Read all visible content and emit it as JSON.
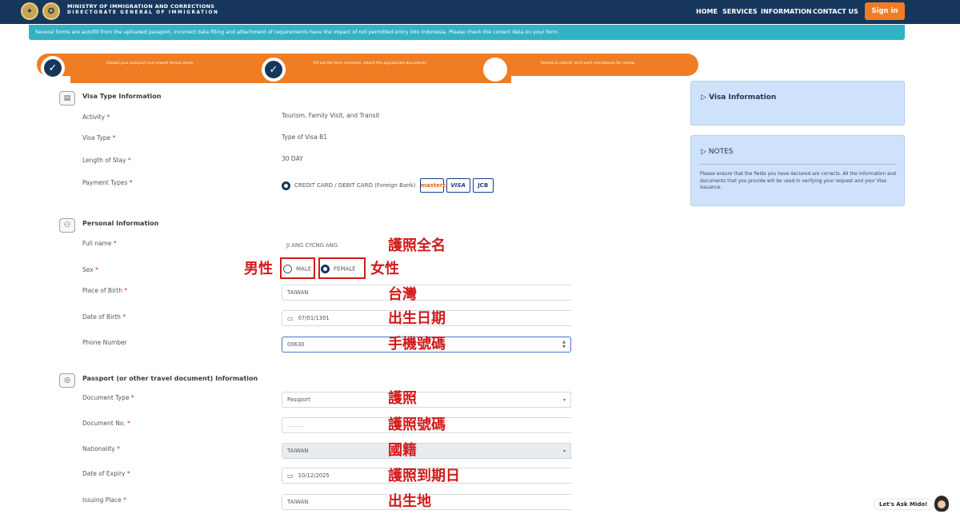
{
  "header": {
    "ministry_line1": "MINISTRY OF IMMIGRATION AND CORRECTIONS",
    "ministry_line2": "DIRECTORATE GENERAL OF IMMIGRATION",
    "nav": [
      "HOME",
      "SERVICES",
      "INFORMATION",
      "CONTACT US"
    ],
    "signin_label": "Sign in",
    "brand_color": "#16365c",
    "accent_color": "#f07d24"
  },
  "notice": "Several forms are autofill from the uploaded passport, incorrect data filling and attachment of requirements have the impact of not permitted entry into Indonesia. Please check the correct data on your form.",
  "steps": [
    {
      "text": "Upload your passport and newest formal photo",
      "status": "done"
    },
    {
      "text": "Fill out the form complete, attach the appropriate documents",
      "status": "done"
    },
    {
      "text": "Review & submit, let it each checkboxes for review",
      "status": "current"
    }
  ],
  "visa_type": {
    "title": "Visa Type Information",
    "activity_label": "Activity",
    "activity_value": "Tourism, Family Visit, and Transit",
    "visa_type_label": "Visa Type",
    "visa_type_value": "Type of Visa B1",
    "length_label": "Length of Stay",
    "length_value": "30 DAY",
    "payment_label": "Payment Types",
    "payment_value": "CREDIT CARD / DEBIT CARD (Foreign Bank)",
    "cards": [
      "mastercard",
      "VISA",
      "JCB"
    ]
  },
  "personal": {
    "title": "Personal Information",
    "full_name_label": "Full name",
    "full_name_value": "JI ANG CYCNG ANG",
    "sex_label": "Sex",
    "sex_male": "MALE",
    "sex_female": "FEMALE",
    "pob_label": "Place of Birth",
    "pob_value": "TAIWAN",
    "dob_label": "Date of Birth",
    "dob_value": "07/01/1301",
    "phone_label": "Phone Number",
    "phone_value": "00630"
  },
  "passport": {
    "title": "Passport (or other travel document) Information",
    "doc_type_label": "Document Type",
    "doc_type_value": "Passport",
    "doc_no_label": "Document No.",
    "doc_no_value": "..........",
    "nationality_label": "Nationality",
    "nationality_value": "TAIWAN",
    "expiry_label": "Date of Expiry",
    "expiry_value": "10/12/2025",
    "issuing_label": "Issuing Place",
    "issuing_value": "TAIWAN"
  },
  "annotations": {
    "full_name": "護照全名",
    "male": "男性",
    "female": "女性",
    "pob": "台灣",
    "dob": "出生日期",
    "phone": "手機號碼",
    "doc_type": "護照",
    "doc_no": "護照號碼",
    "nationality": "國籍",
    "expiry": "護照到期日",
    "issuing": "出生地",
    "color": "#d11a1a"
  },
  "sidebar": {
    "visa_info_title": "Visa Information",
    "notes_title": "NOTES",
    "notes_text": "Please ensure that the fields you have declared are corrects. All the information and documents that you provide will be used in verifying your request and your Visa issuance."
  },
  "chat": {
    "label": "Let's Ask Mido!"
  }
}
